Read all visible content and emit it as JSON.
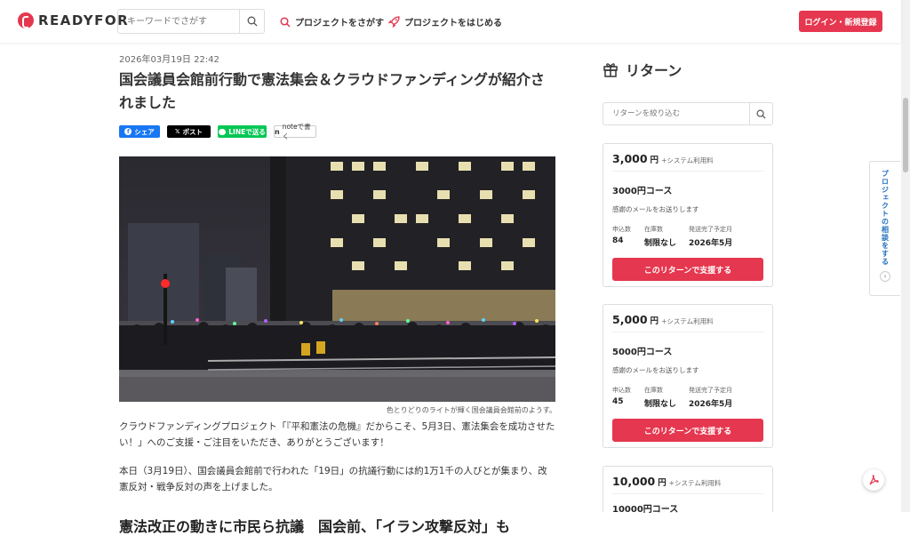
{
  "header": {
    "logo_text": "READYFOR",
    "search_placeholder": "キーワードでさがす",
    "nav_find": "プロジェクトをさがす",
    "nav_start": "プロジェクトをはじめる",
    "login_label": "ログイン・新規登録"
  },
  "article": {
    "date": "2026年03月19日 22:42",
    "title": "国会議員会館前行動で憲法集会＆クラウドファンディングが紹介されました",
    "share": {
      "facebook": "シェア",
      "x": "ポスト",
      "line": "LINEで送る",
      "note": "noteで書く"
    },
    "photo_caption": "色とりどりのライトが輝く国会議員会館前のようす。",
    "paragraph1": "クラウドファンディングプロジェクト「『平和憲法の危機』だからこそ、5月3日、憲法集会を成功させたい！」へのご支援・ご注目をいただき、ありがとうございます！",
    "paragraph2": "本日（3月19日）、国会議員会館前で行われた「19日」の抗議行動には約1万1千の人びとが集まり、改憲反対・戦争反対の声を上げました。",
    "heading2": "憲法改正の動きに市民ら抗議　国会前、「イラン攻撃反対」も"
  },
  "sidebar": {
    "title": "リターン",
    "search_placeholder": "リターンを絞り込む",
    "cards": [
      {
        "price": "3,000",
        "yen": "円",
        "fee": "+システム利用料",
        "name": "3000円コース",
        "desc": "感謝のメールをお送りします",
        "supporters_label": "申込数",
        "supporters": "84",
        "stock_label": "在庫数",
        "stock": "制限なし",
        "ship_label": "発送完了予定月",
        "ship": "2026年5月",
        "button": "このリターンで支援する"
      },
      {
        "price": "5,000",
        "yen": "円",
        "fee": "+システム利用料",
        "name": "5000円コース",
        "desc": "感謝のメールをお送りします",
        "supporters_label": "申込数",
        "supporters": "45",
        "stock_label": "在庫数",
        "stock": "制限なし",
        "ship_label": "発送完了予定月",
        "ship": "2026年5月",
        "button": "このリターンで支援する"
      },
      {
        "price": "10,000",
        "yen": "円",
        "fee": "+システム利用料",
        "name": "10000円コース"
      }
    ]
  },
  "consult_tab": "プロジェクトの相談をする",
  "colors": {
    "brand": "#e5374f",
    "facebook": "#1877f2",
    "line": "#06c755",
    "x": "#000000"
  }
}
